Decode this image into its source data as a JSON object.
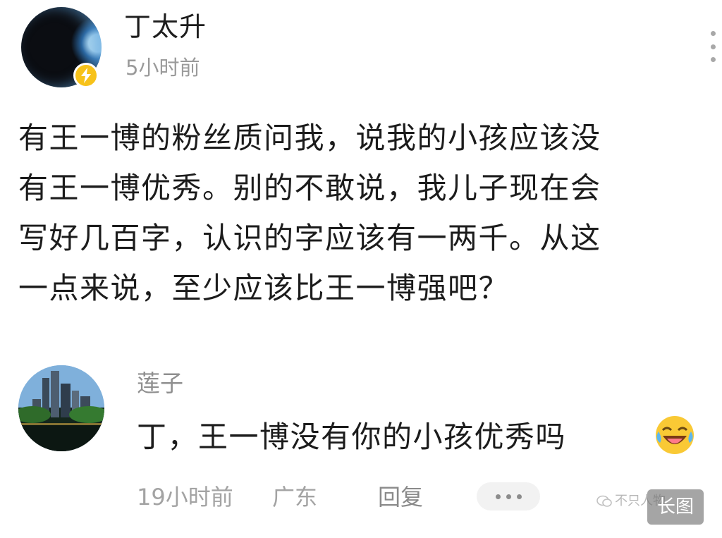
{
  "post": {
    "author": "丁太升",
    "time": "5小时前",
    "body_lines": [
      "有王一博的粉丝质问我，说我的小孩应该没",
      "有王一博优秀。别的不敢说，我儿子现在会",
      "写好几百字，认识的字应该有一两千。从这",
      "一点来说，至少应该比王一博强吧？"
    ],
    "more_icon": "more-vertical-icon",
    "badge_icon": "lightning-icon",
    "badge_color": "#f7c21a"
  },
  "comment": {
    "author": "莲子",
    "text": "丁，王一博没有你的小孩优秀吗",
    "emoji_icon": "laughing-crying-emoji-icon",
    "time": "19小时前",
    "location": "广东",
    "reply_label": "回复",
    "more_icon": "more-horizontal-icon"
  },
  "watermark": {
    "text": "不只人物",
    "badge_label": "长图"
  }
}
